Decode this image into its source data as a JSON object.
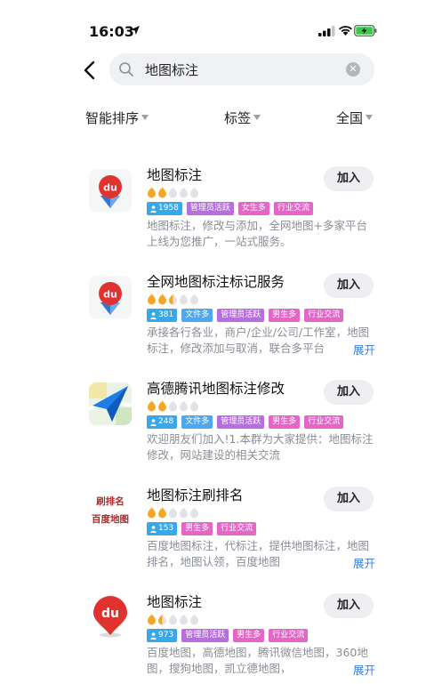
{
  "status_bar": {
    "time": "16:03"
  },
  "search": {
    "query": "地图标注"
  },
  "filters": [
    {
      "label": "智能排序"
    },
    {
      "label": "标签"
    },
    {
      "label": "全国"
    }
  ],
  "join_label": "加入",
  "expand_label": "展开",
  "groups": [
    {
      "title": "地图标注",
      "heat_level": 2,
      "heat_max": 5,
      "member_count": "1958",
      "tags": [
        "管理员活跃",
        "女生多",
        "行业交流"
      ],
      "description": "地图标注，修改与添加，全网地图+多家平台上线为您推广，一站式服务。",
      "icon": "baidu-map-logo"
    },
    {
      "title": "全网地图标注标记服务",
      "heat_level": 2.5,
      "heat_max": 5,
      "member_count": "381",
      "tags": [
        "文件多",
        "管理员活跃",
        "男生多",
        "行业交流"
      ],
      "description": "承接各行各业，商户/企业/公司/工作室，地图标注，修改添加与取消，联合多平台",
      "icon": "baidu-map-logo"
    },
    {
      "title": "高德腾讯地图标注修改",
      "heat_level": 2,
      "heat_max": 5,
      "member_count": "248",
      "tags": [
        "文件多",
        "管理员活跃",
        "男生多",
        "行业交流"
      ],
      "description": "欢迎朋友们加入!1.本群为大家提供：地图标注修改，网站建设的相关交流",
      "icon": "amap-logo"
    },
    {
      "title": "地图标注刷排名",
      "heat_level": 2,
      "heat_max": 5,
      "member_count": "153",
      "tags": [
        "男生多",
        "行业交流"
      ],
      "description": "百度地图标注，代标注，提供地图标注，地图排名，地图认领，百度地图",
      "icon": "text-logo",
      "logo_lines": [
        "刷排名",
        "百度地图"
      ]
    },
    {
      "title": "地图标注",
      "heat_level": 1.5,
      "heat_max": 5,
      "member_count": "973",
      "tags": [
        "管理员活跃",
        "男生多",
        "行业交流"
      ],
      "description": "百度地图，高德地图，腾讯微信地图，360地图，搜狗地图，凯立德地图，",
      "icon": "baidu-pin-logo"
    }
  ],
  "colors": {
    "accent_blue": "#3a7ee3",
    "tag_count": "#3aa8e8",
    "tag_pink": "#e466c6",
    "tag_purple": "#b76ee0",
    "flame_on": "#f5a623",
    "flame_off": "#e2e2e6"
  }
}
